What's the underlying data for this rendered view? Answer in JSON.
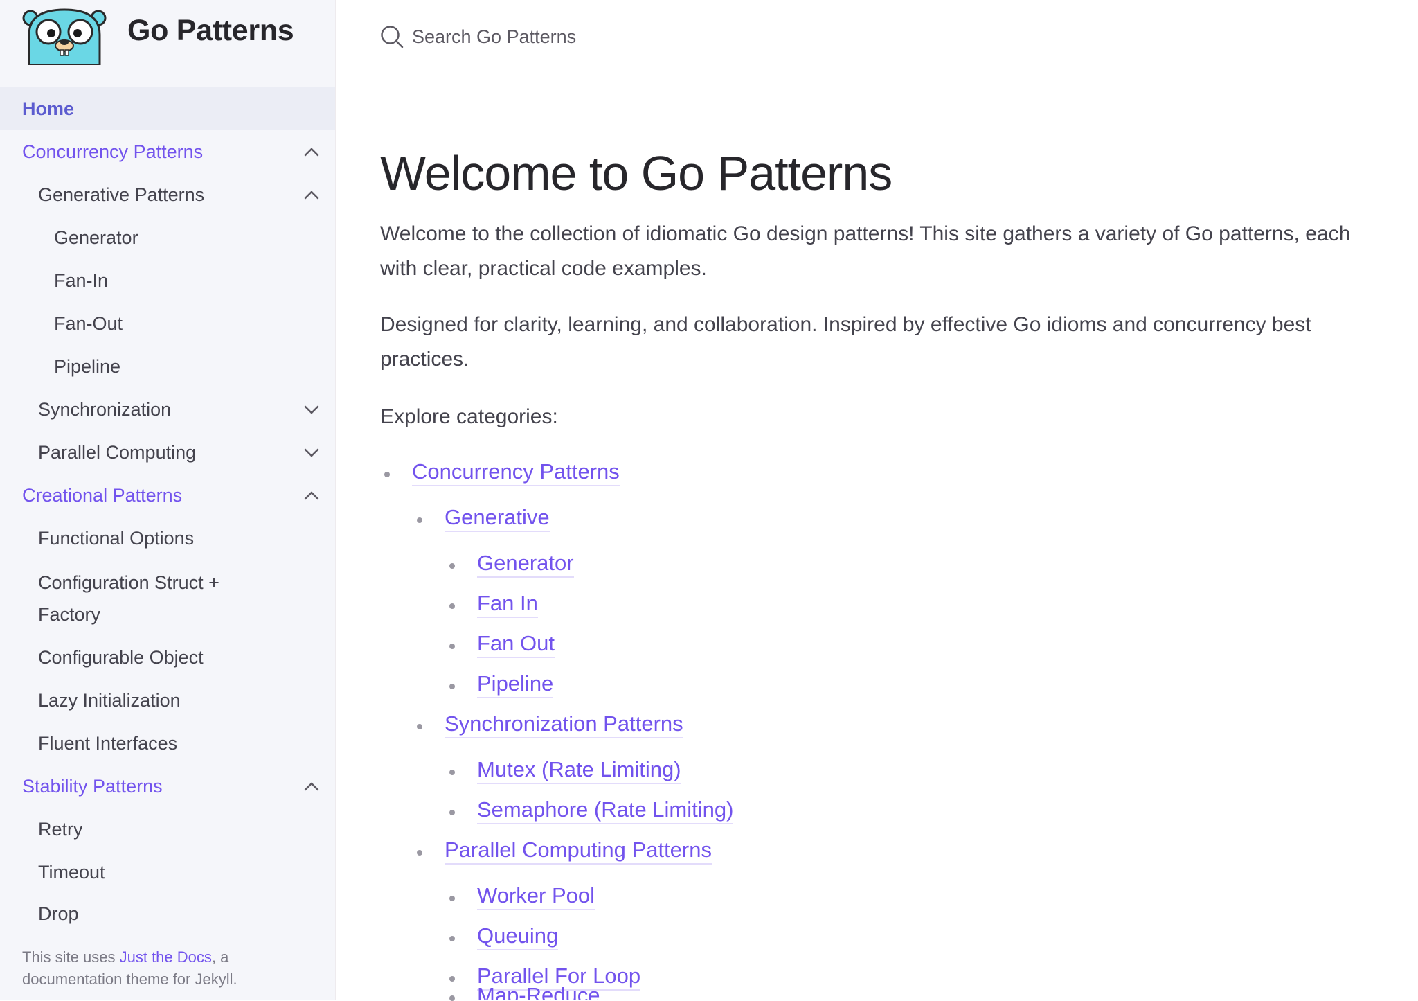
{
  "site": {
    "title": "Go Patterns"
  },
  "search": {
    "placeholder": "Search Go Patterns"
  },
  "nav": {
    "home": "Home",
    "concurrency": "Concurrency Patterns",
    "generative": "Generative Patterns",
    "generator": "Generator",
    "fan_in": "Fan-In",
    "fan_out": "Fan-Out",
    "pipeline": "Pipeline",
    "synchronization": "Synchronization",
    "parallel_computing": "Parallel Computing",
    "creational": "Creational Patterns",
    "functional_options": "Functional Options",
    "config_struct_factory": "Configuration Struct + Factory",
    "configurable_object": "Configurable Object",
    "lazy_initialization": "Lazy Initialization",
    "fluent_interfaces": "Fluent Interfaces",
    "stability": "Stability Patterns",
    "retry": "Retry",
    "timeout": "Timeout",
    "drop": "Drop"
  },
  "footer": {
    "prefix": "This site uses ",
    "link": "Just the Docs",
    "suffix": ", a documentation theme for Jekyll."
  },
  "main": {
    "title": "Welcome to Go Patterns",
    "intro": "Welcome to the collection of idiomatic Go design patterns! This site gathers a variety of Go patterns, each with clear, practical code examples.",
    "designed": "Designed for clarity, learning, and collaboration. Inspired by effective Go idioms and concurrency best practices.",
    "explore": "Explore categories:",
    "links": {
      "concurrency": "Concurrency Patterns",
      "generative": "Generative",
      "generator": "Generator",
      "fan_in": "Fan In",
      "fan_out": "Fan Out",
      "pipeline": "Pipeline",
      "synchronization": "Synchronization Patterns",
      "mutex": "Mutex (Rate Limiting)",
      "semaphore": "Semaphore (Rate Limiting)",
      "parallel": "Parallel Computing Patterns",
      "worker_pool": "Worker Pool",
      "queuing": "Queuing",
      "parallel_for": "Parallel For Loop",
      "map_reduce": "Map-Reduce"
    }
  },
  "colors": {
    "accent": "#7253ed",
    "sidebar_bg": "#f5f6fa",
    "text": "#27262b"
  }
}
